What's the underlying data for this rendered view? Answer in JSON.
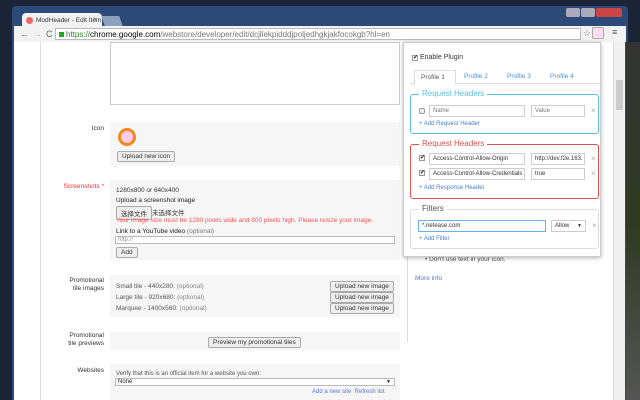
{
  "browser": {
    "tab_title": "ModHeader - Edit Item",
    "url_scheme": "https://",
    "url_domain": "chrome.google.com",
    "url_path": "/webstore/developer/edit/dcjllekpidddjpoljedhgkjakfocokgb?hl=en"
  },
  "form": {
    "icon_label": "Icon",
    "upload_icon": "Upload new icon",
    "screenshots_label": "Screenshots *",
    "screenshot_size": "1280x800 or 640x400",
    "upload_screenshot": "Upload a screenshot image",
    "choose_file": "选择文件",
    "no_file": "未选择文件",
    "error": "Your image size must be 1280 pixels wide and 800 pixels high. Please resize your image.",
    "youtube_label": "Link to a YouTube video",
    "optional": "(optional)",
    "youtube_placeholder": "http://",
    "add": "Add",
    "promo_label_1": "Promotional",
    "promo_label_2": "tile images",
    "tiles": [
      {
        "name": "Small tile - 440x280:",
        "opt": "(optional)"
      },
      {
        "name": "Large tile - 920x680:",
        "opt": "(optional)"
      },
      {
        "name": "Marquee - 1400x560:",
        "opt": "(optional)"
      }
    ],
    "upload_image": "Upload new image",
    "previews_label_1": "Promotional",
    "previews_label_2": "tile previews",
    "preview_btn": "Preview my promotional tiles",
    "websites_label": "Websites",
    "verify": "Verify that this is an official item for a website you own:",
    "site_value": "None",
    "add_site": "Add a new site",
    "refresh": "Refresh list"
  },
  "sidebar": {
    "tip": "Don't use text in your icon.",
    "more_info": "More info"
  },
  "popup": {
    "enable": "Enable Plugin",
    "enabled": true,
    "profiles": [
      "Profile 1",
      "Profile 2",
      "Profile 3",
      "Profile 4"
    ],
    "active_profile": 0,
    "request": {
      "title": "Request Headers",
      "rows": [
        {
          "checked": false,
          "name": "Name",
          "value": "Value"
        }
      ],
      "add": "+ Add Request Header"
    },
    "response": {
      "title": "Request Headers",
      "rows": [
        {
          "checked": true,
          "name": "Access-Control-Allow-Origin",
          "value": "http://dev.f2e.163."
        },
        {
          "checked": true,
          "name": "Access-Control-Allow-Credentials",
          "value": "true"
        }
      ],
      "add": "+ Add Response Header"
    },
    "filters": {
      "title": "Filters",
      "value": "*.netease.com",
      "mode": "Allow",
      "add": "+ Add Filter"
    },
    "colors": {
      "request": "#5bc0de",
      "response": "#d9534f"
    }
  }
}
